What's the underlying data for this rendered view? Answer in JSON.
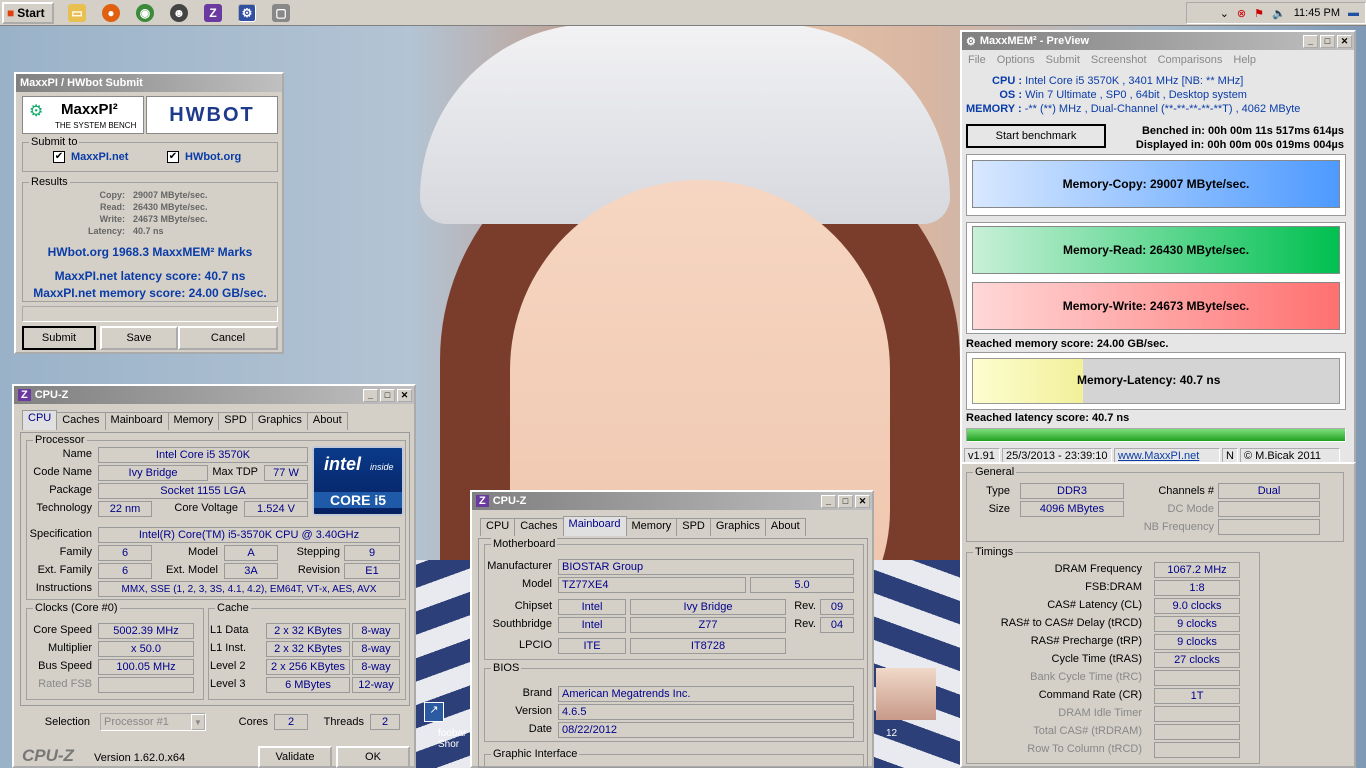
{
  "taskbar": {
    "start": "Start",
    "time": "11:45 PM",
    "pinned": [
      "folder-icon",
      "firefox-icon",
      "chrome-icon",
      "alien-icon",
      "cpuz-icon",
      "maxxmem-icon",
      "window-icon"
    ]
  },
  "desktop": {
    "icon_label": "foobar Shor",
    "thumb_label": "12"
  },
  "hwbot": {
    "title": "MaxxPI / HWbot Submit",
    "logo_left": "MaxxPI²",
    "logo_sub": "THE SYSTEM BENCH",
    "logo_right": "HWBOT",
    "submit_to_label": "Submit to",
    "opt1": "MaxxPI.net",
    "opt2": "HWbot.org",
    "results_label": "Results",
    "results": [
      {
        "k": "Copy:",
        "v": "29007 MByte/sec."
      },
      {
        "k": "Read:",
        "v": "26430 MByte/sec."
      },
      {
        "k": "Write:",
        "v": "24673 MByte/sec."
      },
      {
        "k": "Latency:",
        "v": "40.7 ns"
      }
    ],
    "score1": "HWbot.org  1968.3  MaxxMEM² Marks",
    "score2": "MaxxPI.net latency score:  40.7  ns",
    "score3": "MaxxPI.net memory score:  24.00  GB/sec.",
    "submit": "Submit",
    "save": "Save",
    "cancel": "Cancel"
  },
  "cpuz1": {
    "title": "CPU-Z",
    "tabs": [
      "CPU",
      "Caches",
      "Mainboard",
      "Memory",
      "SPD",
      "Graphics",
      "About"
    ],
    "processor_label": "Processor",
    "name_l": "Name",
    "name": "Intel Core i5 3570K",
    "code_l": "Code Name",
    "code": "Ivy Bridge",
    "tdp_l": "Max TDP",
    "tdp": "77 W",
    "pkg_l": "Package",
    "pkg": "Socket 1155 LGA",
    "tech_l": "Technology",
    "tech": "22 nm",
    "volt_l": "Core Voltage",
    "volt": "1.524 V",
    "spec_l": "Specification",
    "spec": "Intel(R) Core(TM) i5-3570K CPU @ 3.40GHz",
    "fam_l": "Family",
    "fam": "6",
    "model_l": "Model",
    "model": "A",
    "step_l": "Stepping",
    "step": "9",
    "efam_l": "Ext. Family",
    "efam": "6",
    "emodel_l": "Ext. Model",
    "emodel": "3A",
    "rev_l": "Revision",
    "rev": "E1",
    "instr_l": "Instructions",
    "instr": "MMX, SSE (1, 2, 3, 3S, 4.1, 4.2), EM64T, VT-x, AES, AVX",
    "logo_top": "intel",
    "logo_inside": "inside",
    "logo_core": "CORE i5",
    "clocks_label": "Clocks (Core #0)",
    "cs_l": "Core Speed",
    "cs": "5002.39 MHz",
    "mult_l": "Multiplier",
    "mult": "x 50.0",
    "bus_l": "Bus Speed",
    "bus": "100.05 MHz",
    "fsb_l": "Rated FSB",
    "fsb": "",
    "cache_label": "Cache",
    "cache": [
      {
        "k": "L1 Data",
        "v": "2 x 32 KBytes",
        "w": "8-way"
      },
      {
        "k": "L1 Inst.",
        "v": "2 x 32 KBytes",
        "w": "8-way"
      },
      {
        "k": "Level 2",
        "v": "2 x 256 KBytes",
        "w": "8-way"
      },
      {
        "k": "Level 3",
        "v": "6 MBytes",
        "w": "12-way"
      }
    ],
    "sel_l": "Selection",
    "sel": "Processor #1",
    "cores_l": "Cores",
    "cores": "2",
    "threads_l": "Threads",
    "threads": "2",
    "brand": "CPU-Z",
    "version": "Version 1.62.0.x64",
    "validate": "Validate",
    "ok": "OK"
  },
  "cpuz2": {
    "title": "CPU-Z",
    "tabs": [
      "CPU",
      "Caches",
      "Mainboard",
      "Memory",
      "SPD",
      "Graphics",
      "About"
    ],
    "mb_label": "Motherboard",
    "manu_l": "Manufacturer",
    "manu": "BIOSTAR Group",
    "model_l": "Model",
    "model": "TZ77XE4",
    "model_rev": "5.0",
    "chip_l": "Chipset",
    "chip1": "Intel",
    "chip2": "Ivy Bridge",
    "rev_l": "Rev.",
    "chip_rev": "09",
    "sb_l": "Southbridge",
    "sb1": "Intel",
    "sb2": "Z77",
    "sb_rev": "04",
    "lpc_l": "LPCIO",
    "lpc1": "ITE",
    "lpc2": "IT8728",
    "bios_label": "BIOS",
    "brand_l": "Brand",
    "brand": "American Megatrends Inc.",
    "ver_l": "Version",
    "ver": "4.6.5",
    "date_l": "Date",
    "date": "08/22/2012",
    "gi_label": "Graphic Interface"
  },
  "maxxmem": {
    "title": "MaxxMEM² - PreView",
    "menu": [
      "File",
      "Options",
      "Submit",
      "Screenshot",
      "Comparisons",
      "Help"
    ],
    "cpu_l": "CPU :",
    "cpu": "Intel Core i5 3570K , 3401 MHz  [NB: ** MHz]",
    "os_l": "OS :",
    "os": "Win 7 Ultimate , SP0 , 64bit , Desktop system",
    "mem_l": "MEMORY :",
    "mem": "-** (**) MHz , Dual-Channel (**-**-**-**-**T) , 4062 MByte",
    "start": "Start benchmark",
    "bench": "Benched in: 00h 00m 11s 517ms 614µs",
    "disp": "Displayed in: 00h 00m 00s 019ms 004µs",
    "copy": "Memory-Copy: 29007 MByte/sec.",
    "read": "Memory-Read: 26430 MByte/sec.",
    "write": "Memory-Write: 24673 MByte/sec.",
    "reached_mem": "Reached memory score: 24.00 GB/sec.",
    "latency": "Memory-Latency: 40.7 ns",
    "latency_fill": 0.3,
    "reached_lat": "Reached latency score: 40.7 ns",
    "progress": 1.0,
    "status": [
      "v1.91",
      "25/3/2013 - 23:39:10",
      "www.MaxxPI.net",
      "N",
      "© M.Bicak 2011"
    ],
    "accent_copy": "#4d9aff",
    "accent_read": "#00c050",
    "accent_write": "#ff7070",
    "accent_lat": "#f2f09a"
  },
  "memtab": {
    "general_label": "General",
    "type_l": "Type",
    "type": "DDR3",
    "ch_l": "Channels #",
    "ch": "Dual",
    "size_l": "Size",
    "size": "4096 MBytes",
    "dc_l": "DC Mode",
    "nb_l": "NB Frequency",
    "timings_label": "Timings",
    "timings": [
      {
        "k": "DRAM Frequency",
        "v": "1067.2 MHz",
        "g": false
      },
      {
        "k": "FSB:DRAM",
        "v": "1:8",
        "g": false
      },
      {
        "k": "CAS# Latency (CL)",
        "v": "9.0 clocks",
        "g": false
      },
      {
        "k": "RAS# to CAS# Delay (tRCD)",
        "v": "9 clocks",
        "g": false
      },
      {
        "k": "RAS# Precharge (tRP)",
        "v": "9 clocks",
        "g": false
      },
      {
        "k": "Cycle Time (tRAS)",
        "v": "27 clocks",
        "g": false
      },
      {
        "k": "Bank Cycle Time (tRC)",
        "v": "",
        "g": true
      },
      {
        "k": "Command Rate (CR)",
        "v": "1T",
        "g": false
      },
      {
        "k": "DRAM Idle Timer",
        "v": "",
        "g": true
      },
      {
        "k": "Total CAS# (tRDRAM)",
        "v": "",
        "g": true
      },
      {
        "k": "Row To Column (tRCD)",
        "v": "",
        "g": true
      }
    ]
  }
}
